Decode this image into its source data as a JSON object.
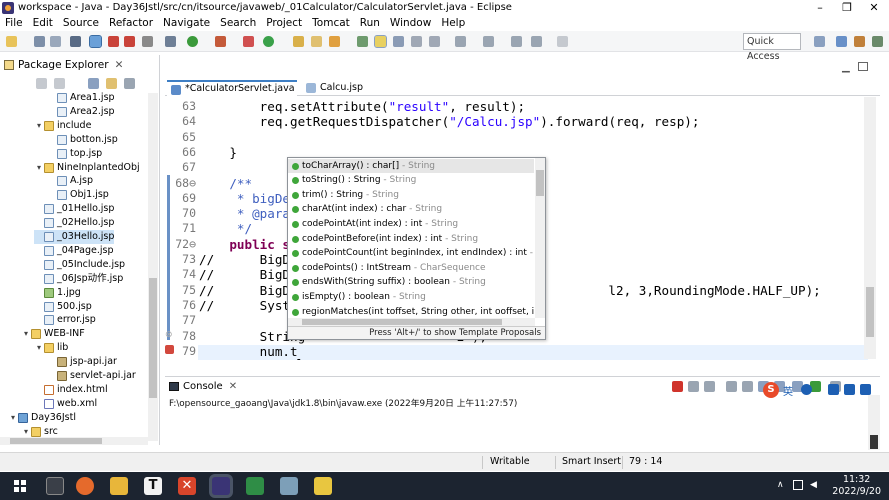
{
  "window": {
    "title": "workspace - Java - Day36Jstl/src/cn/itsource/javaweb/_01Calculator/CalculatorServlet.java - Eclipse",
    "minimize": "–",
    "restore": "❐",
    "close": "✕"
  },
  "menu": [
    "File",
    "Edit",
    "Source",
    "Refactor",
    "Navigate",
    "Search",
    "Project",
    "Tomcat",
    "Run",
    "Window",
    "Help"
  ],
  "toolbar": {
    "quick_access_placeholder": "Quick Access"
  },
  "explorer": {
    "title": "Package Explorer",
    "close": "✕",
    "items": [
      {
        "label": "Area1.jsp",
        "type": "jsp",
        "indent": 3,
        "twisty": ""
      },
      {
        "label": "Area2.jsp",
        "type": "jsp",
        "indent": 3,
        "twisty": ""
      },
      {
        "label": "include",
        "type": "folder",
        "indent": 2,
        "twisty": "▾"
      },
      {
        "label": "botton.jsp",
        "type": "jsp",
        "indent": 3,
        "twisty": ""
      },
      {
        "label": "top.jsp",
        "type": "jsp",
        "indent": 3,
        "twisty": ""
      },
      {
        "label": "NineInplantedObj",
        "type": "folder",
        "indent": 2,
        "twisty": "▾"
      },
      {
        "label": "A.jsp",
        "type": "jsp",
        "indent": 3,
        "twisty": ""
      },
      {
        "label": "Obj1.jsp",
        "type": "jsp",
        "indent": 3,
        "twisty": ""
      },
      {
        "label": "_01Hello.jsp",
        "type": "jsp",
        "indent": 2,
        "twisty": ""
      },
      {
        "label": "_02Hello.jsp",
        "type": "jsp",
        "indent": 2,
        "twisty": ""
      },
      {
        "label": "_03Hello.jsp",
        "type": "jsp",
        "indent": 2,
        "twisty": "",
        "selected": true
      },
      {
        "label": "_04Page.jsp",
        "type": "jsp",
        "indent": 2,
        "twisty": ""
      },
      {
        "label": "_05Include.jsp",
        "type": "jsp",
        "indent": 2,
        "twisty": ""
      },
      {
        "label": "_06Jsp动作.jsp",
        "type": "jsp",
        "indent": 2,
        "twisty": ""
      },
      {
        "label": "1.jpg",
        "type": "img",
        "indent": 2,
        "twisty": ""
      },
      {
        "label": "500.jsp",
        "type": "jsp",
        "indent": 2,
        "twisty": ""
      },
      {
        "label": "error.jsp",
        "type": "jsp",
        "indent": 2,
        "twisty": ""
      },
      {
        "label": "WEB-INF",
        "type": "folder",
        "indent": 1,
        "twisty": "▾"
      },
      {
        "label": "lib",
        "type": "folder",
        "indent": 2,
        "twisty": "▾"
      },
      {
        "label": "jsp-api.jar",
        "type": "jar",
        "indent": 3,
        "twisty": ""
      },
      {
        "label": "servlet-api.jar",
        "type": "jar",
        "indent": 3,
        "twisty": ""
      },
      {
        "label": "index.html",
        "type": "html",
        "indent": 2,
        "twisty": ""
      },
      {
        "label": "web.xml",
        "type": "xml",
        "indent": 2,
        "twisty": ""
      },
      {
        "label": "Day36Jstl",
        "type": "proj",
        "indent": 0,
        "twisty": "▾"
      },
      {
        "label": "src",
        "type": "folder",
        "indent": 1,
        "twisty": "▾"
      }
    ]
  },
  "editor": {
    "tabs": [
      {
        "label": "*CalculatorServlet.java",
        "close": "✕",
        "active": true
      },
      {
        "label": "Calcu.jsp",
        "close": "",
        "active": false
      }
    ],
    "lines": [
      {
        "n": "63",
        "html": "        req.setAttribute(<span class=\"str\">\"result\"</span>, result);"
      },
      {
        "n": "64",
        "html": "        req.getRequestDispatcher(<span class=\"str\">\"/Calcu.jsp\"</span>).forward(req, resp);"
      },
      {
        "n": "65",
        "html": ""
      },
      {
        "n": "66",
        "html": "    }"
      },
      {
        "n": "67",
        "html": ""
      },
      {
        "n": "68⊖",
        "html": "    <span class=\"cm\">/**</span>"
      },
      {
        "n": "69",
        "html": "<span class=\"cm\">     * bigDec</span>"
      },
      {
        "n": "70",
        "html": "<span class=\"cm\">     * @param</span>"
      },
      {
        "n": "71",
        "html": "<span class=\"cm\">     */</span>"
      },
      {
        "n": "72⊖",
        "html": "    <span class=\"kw\">public st</span>"
      },
      {
        "n": "73",
        "html": "//      BigDe"
      },
      {
        "n": "74",
        "html": "//      BigDe"
      },
      {
        "n": "75",
        "html": "//      BigDe                                         l2, 3,RoundingMode.HALF_UP);"
      },
      {
        "n": "76",
        "html": "//      Syste"
      },
      {
        "n": "77",
        "html": ""
      },
      {
        "n": "78",
        "html": "        String                    2\");"
      },
      {
        "n": "79",
        "html": "        num.t"
      }
    ]
  },
  "content_assist": {
    "items": [
      {
        "sig": "toCharArray() : char[]",
        "ret": " - String",
        "selected": true
      },
      {
        "sig": "toString() : String",
        "ret": " - String"
      },
      {
        "sig": "trim() : String",
        "ret": " - String"
      },
      {
        "sig": "charAt(int index) : char",
        "ret": " - String"
      },
      {
        "sig": "codePointAt(int index) : int",
        "ret": " - String"
      },
      {
        "sig": "codePointBefore(int index) : int",
        "ret": " - String"
      },
      {
        "sig": "codePointCount(int beginIndex, int endIndex) : int",
        "ret": " - String"
      },
      {
        "sig": "codePoints() : IntStream",
        "ret": " - CharSequence"
      },
      {
        "sig": "endsWith(String suffix) : boolean",
        "ret": " - String"
      },
      {
        "sig": "isEmpty() : boolean",
        "ret": " - String"
      },
      {
        "sig": "regionMatches(int toffset, String other, int ooffset, int len)",
        "ret": ""
      }
    ],
    "footer": "Press 'Alt+/' to show Template Proposals"
  },
  "console": {
    "title": "Console",
    "close": "✕",
    "line": "F:\\opensource_gaoang\\Java\\jdk1.8\\bin\\javaw.exe (2022年9月20日 上午11:27:57)"
  },
  "status": {
    "writable": "Writable",
    "insert_mode": "Smart Insert",
    "position": "79 : 14"
  },
  "taskbar": {
    "time": "11:32",
    "date": "2022/9/20",
    "ime": "英"
  }
}
